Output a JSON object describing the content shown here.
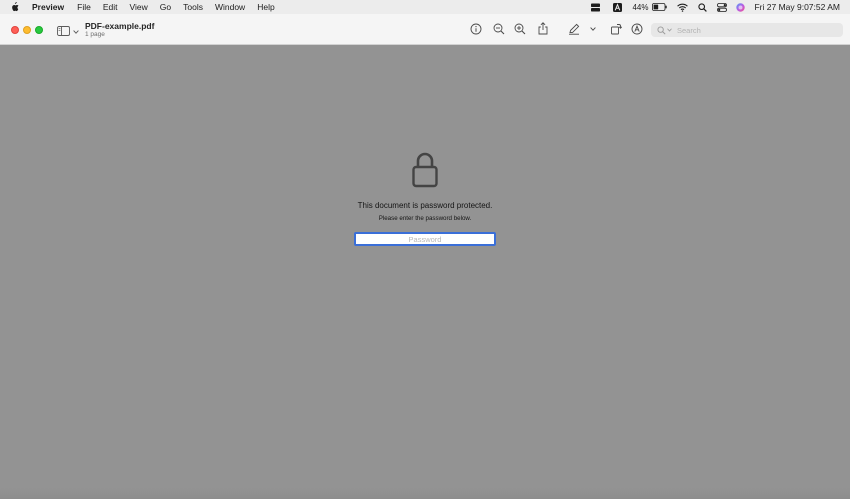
{
  "menubar": {
    "app_name": "Preview",
    "items": [
      "File",
      "Edit",
      "View",
      "Go",
      "Tools",
      "Window",
      "Help"
    ],
    "battery_percent": "44%",
    "battery_level": 0.44,
    "clock": "Fri 27 May  9:07:52 AM"
  },
  "toolbar": {
    "document_title": "PDF-example.pdf",
    "page_count": "1 page",
    "search_placeholder": "Search"
  },
  "icons": {
    "info": "info-icon",
    "zoom_out": "zoom-out-icon",
    "zoom_in": "zoom-in-icon",
    "share": "share-icon",
    "markup": "pencil-icon",
    "rotate": "rotate-icon",
    "annotate": "markup-circle-icon",
    "lock": "lock-icon"
  },
  "colors": {
    "focus_ring": "#3a6fd8",
    "close": "#fe5f57",
    "minimize": "#febc2e",
    "maximize": "#28c840",
    "content_bg": "#939393"
  },
  "content": {
    "protected_message": "This document is password protected.",
    "enter_message": "Please enter the password below.",
    "password_placeholder": "Password"
  }
}
